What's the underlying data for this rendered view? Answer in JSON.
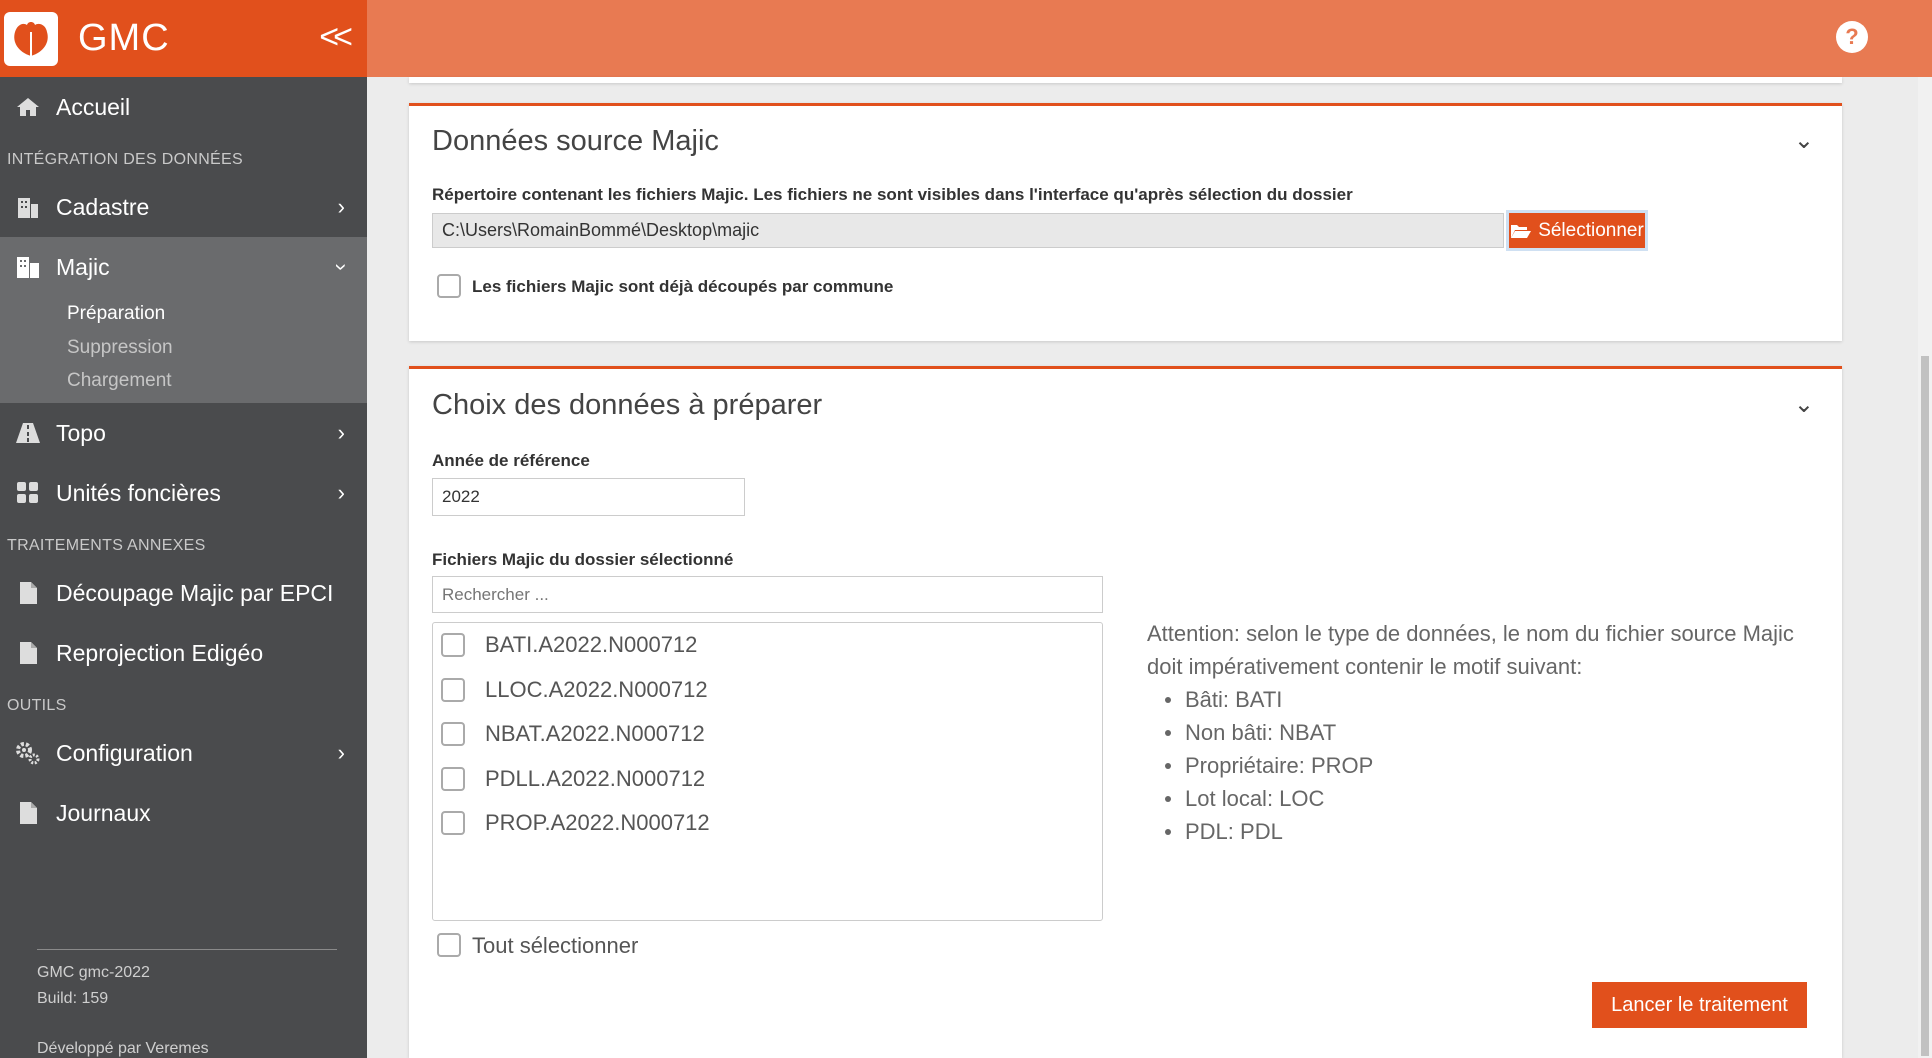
{
  "app": {
    "name": "GMC"
  },
  "sidebar": {
    "home": "Accueil",
    "section1": "INTÉGRATION DES DONNÉES",
    "cadastre": "Cadastre",
    "majic": "Majic",
    "majic_sub": [
      "Préparation",
      "Suppression",
      "Chargement"
    ],
    "topo": "Topo",
    "unites": "Unités foncières",
    "section2": "TRAITEMENTS ANNEXES",
    "decoupage": "Découpage Majic par EPCI",
    "reprojection": "Reprojection Edigéo",
    "section3": "OUTILS",
    "configuration": "Configuration",
    "journaux": "Journaux",
    "footer": {
      "version": "GMC gmc-2022",
      "build": "Build: 159",
      "dev": "Développé par Veremes"
    }
  },
  "source_panel": {
    "title": "Données source Majic",
    "dir_label": "Répertoire contenant les fichiers Majic. Les fichiers ne sont visibles dans l'interface qu'après sélection du dossier",
    "dir_value": "C:\\Users\\RomainBommé\\Desktop\\majic",
    "select_button": "Sélectionner",
    "split_checkbox": "Les fichiers Majic sont déjà découpés par commune"
  },
  "choice_panel": {
    "title": "Choix des données à préparer",
    "year_label": "Année de référence",
    "year_value": "2022",
    "files_label": "Fichiers Majic du dossier sélectionné",
    "search_placeholder": "Rechercher ...",
    "files": [
      "BATI.A2022.N000712",
      "LLOC.A2022.N000712",
      "NBAT.A2022.N000712",
      "PDLL.A2022.N000712",
      "PROP.A2022.N000712"
    ],
    "select_all": "Tout sélectionner",
    "attention_text": "Attention: selon le type de données, le nom du fichier source Majic doit impérativement contenir le motif suivant:",
    "patterns": [
      "Bâti: BATI",
      "Non bâti: NBAT",
      "Propriétaire: PROP",
      "Lot local: LOC",
      "PDL: PDL"
    ],
    "launch_button": "Lancer le traitement"
  },
  "colors": {
    "accent": "#e1501c",
    "topbar": "#e87a52",
    "sidebar": "#4a4b4d"
  }
}
